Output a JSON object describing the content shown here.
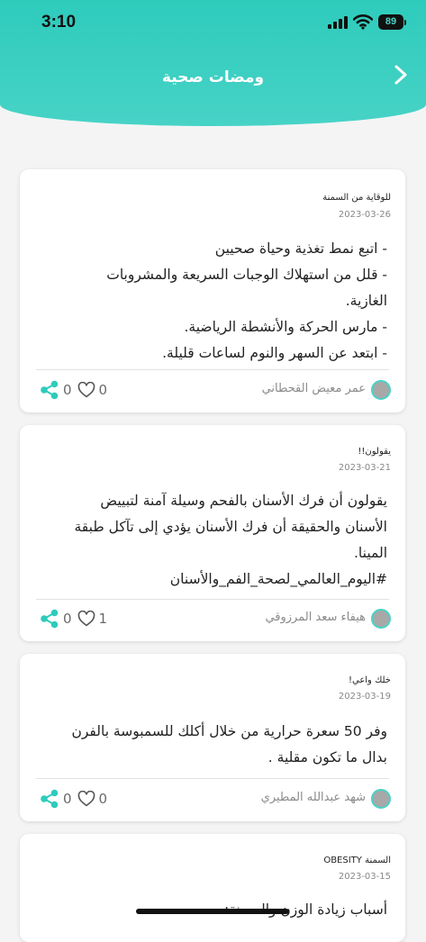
{
  "status_bar": {
    "time": "3:10",
    "battery": "89"
  },
  "header": {
    "title": "ومضات صحية"
  },
  "posts": [
    {
      "category": "للوقاية من السمنة",
      "date": "2023-03-26",
      "lines": [
        "- اتبع نمط تغذية وحياة صحيين",
        "-  قلل من استهلاك الوجبات السريعة والمشروبات",
        "الغازية.",
        "-  مارس الحركة والأنشطة الرياضية.",
        "- ابتعد عن السهر والنوم لساعات قليلة."
      ],
      "author": "عمر معيض القحطاني",
      "likes": "0",
      "shares": "0"
    },
    {
      "category": "يقولون!!",
      "date": "2023-03-21",
      "lines": [
        "يقولون أن فرك الأسنان بالفحم وسيلة آمنة لتبييض",
        "الأسنان والحقيقة أن فرك الأسنان يؤدي إلى تآكل طبقة",
        "المينا.",
        "#اليوم_العالمي_لصحة_الفم_والأسنان"
      ],
      "author": "هيفاء سعد المرزوقي",
      "likes": "1",
      "shares": "0"
    },
    {
      "category": "خلك واعي!",
      "date": "2023-03-19",
      "lines": [
        "وفر 50 سعرة حرارية من خلال أكلك للسمبوسة بالفرن",
        "بدال ما تكون مقلية ."
      ],
      "author": "شهد عبدالله المطيري",
      "likes": "0",
      "shares": "0"
    },
    {
      "category": "السمنة OBESITY",
      "date": "2023-03-15",
      "lines": [
        "أسباب زيادة الوزن والسمنة:"
      ]
    }
  ],
  "colors": {
    "accent": "#2ecbbc",
    "background": "#f4f4f5"
  },
  "icons": {
    "back": "chevron-right-icon",
    "like": "heart-icon",
    "share": "share-icon"
  }
}
